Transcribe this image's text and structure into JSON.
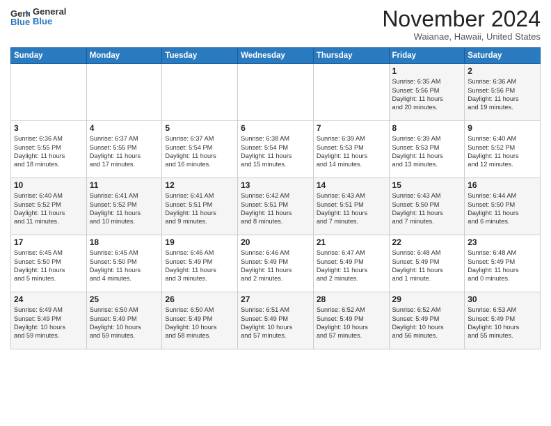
{
  "header": {
    "logo_line1": "General",
    "logo_line2": "Blue",
    "month": "November 2024",
    "location": "Waianae, Hawaii, United States"
  },
  "weekdays": [
    "Sunday",
    "Monday",
    "Tuesday",
    "Wednesday",
    "Thursday",
    "Friday",
    "Saturday"
  ],
  "weeks": [
    [
      {
        "day": "",
        "info": ""
      },
      {
        "day": "",
        "info": ""
      },
      {
        "day": "",
        "info": ""
      },
      {
        "day": "",
        "info": ""
      },
      {
        "day": "",
        "info": ""
      },
      {
        "day": "1",
        "info": "Sunrise: 6:35 AM\nSunset: 5:56 PM\nDaylight: 11 hours\nand 20 minutes."
      },
      {
        "day": "2",
        "info": "Sunrise: 6:36 AM\nSunset: 5:56 PM\nDaylight: 11 hours\nand 19 minutes."
      }
    ],
    [
      {
        "day": "3",
        "info": "Sunrise: 6:36 AM\nSunset: 5:55 PM\nDaylight: 11 hours\nand 18 minutes."
      },
      {
        "day": "4",
        "info": "Sunrise: 6:37 AM\nSunset: 5:55 PM\nDaylight: 11 hours\nand 17 minutes."
      },
      {
        "day": "5",
        "info": "Sunrise: 6:37 AM\nSunset: 5:54 PM\nDaylight: 11 hours\nand 16 minutes."
      },
      {
        "day": "6",
        "info": "Sunrise: 6:38 AM\nSunset: 5:54 PM\nDaylight: 11 hours\nand 15 minutes."
      },
      {
        "day": "7",
        "info": "Sunrise: 6:39 AM\nSunset: 5:53 PM\nDaylight: 11 hours\nand 14 minutes."
      },
      {
        "day": "8",
        "info": "Sunrise: 6:39 AM\nSunset: 5:53 PM\nDaylight: 11 hours\nand 13 minutes."
      },
      {
        "day": "9",
        "info": "Sunrise: 6:40 AM\nSunset: 5:52 PM\nDaylight: 11 hours\nand 12 minutes."
      }
    ],
    [
      {
        "day": "10",
        "info": "Sunrise: 6:40 AM\nSunset: 5:52 PM\nDaylight: 11 hours\nand 11 minutes."
      },
      {
        "day": "11",
        "info": "Sunrise: 6:41 AM\nSunset: 5:52 PM\nDaylight: 11 hours\nand 10 minutes."
      },
      {
        "day": "12",
        "info": "Sunrise: 6:41 AM\nSunset: 5:51 PM\nDaylight: 11 hours\nand 9 minutes."
      },
      {
        "day": "13",
        "info": "Sunrise: 6:42 AM\nSunset: 5:51 PM\nDaylight: 11 hours\nand 8 minutes."
      },
      {
        "day": "14",
        "info": "Sunrise: 6:43 AM\nSunset: 5:51 PM\nDaylight: 11 hours\nand 7 minutes."
      },
      {
        "day": "15",
        "info": "Sunrise: 6:43 AM\nSunset: 5:50 PM\nDaylight: 11 hours\nand 7 minutes."
      },
      {
        "day": "16",
        "info": "Sunrise: 6:44 AM\nSunset: 5:50 PM\nDaylight: 11 hours\nand 6 minutes."
      }
    ],
    [
      {
        "day": "17",
        "info": "Sunrise: 6:45 AM\nSunset: 5:50 PM\nDaylight: 11 hours\nand 5 minutes."
      },
      {
        "day": "18",
        "info": "Sunrise: 6:45 AM\nSunset: 5:50 PM\nDaylight: 11 hours\nand 4 minutes."
      },
      {
        "day": "19",
        "info": "Sunrise: 6:46 AM\nSunset: 5:49 PM\nDaylight: 11 hours\nand 3 minutes."
      },
      {
        "day": "20",
        "info": "Sunrise: 6:46 AM\nSunset: 5:49 PM\nDaylight: 11 hours\nand 2 minutes."
      },
      {
        "day": "21",
        "info": "Sunrise: 6:47 AM\nSunset: 5:49 PM\nDaylight: 11 hours\nand 2 minutes."
      },
      {
        "day": "22",
        "info": "Sunrise: 6:48 AM\nSunset: 5:49 PM\nDaylight: 11 hours\nand 1 minute."
      },
      {
        "day": "23",
        "info": "Sunrise: 6:48 AM\nSunset: 5:49 PM\nDaylight: 11 hours\nand 0 minutes."
      }
    ],
    [
      {
        "day": "24",
        "info": "Sunrise: 6:49 AM\nSunset: 5:49 PM\nDaylight: 10 hours\nand 59 minutes."
      },
      {
        "day": "25",
        "info": "Sunrise: 6:50 AM\nSunset: 5:49 PM\nDaylight: 10 hours\nand 59 minutes."
      },
      {
        "day": "26",
        "info": "Sunrise: 6:50 AM\nSunset: 5:49 PM\nDaylight: 10 hours\nand 58 minutes."
      },
      {
        "day": "27",
        "info": "Sunrise: 6:51 AM\nSunset: 5:49 PM\nDaylight: 10 hours\nand 57 minutes."
      },
      {
        "day": "28",
        "info": "Sunrise: 6:52 AM\nSunset: 5:49 PM\nDaylight: 10 hours\nand 57 minutes."
      },
      {
        "day": "29",
        "info": "Sunrise: 6:52 AM\nSunset: 5:49 PM\nDaylight: 10 hours\nand 56 minutes."
      },
      {
        "day": "30",
        "info": "Sunrise: 6:53 AM\nSunset: 5:49 PM\nDaylight: 10 hours\nand 55 minutes."
      }
    ]
  ]
}
